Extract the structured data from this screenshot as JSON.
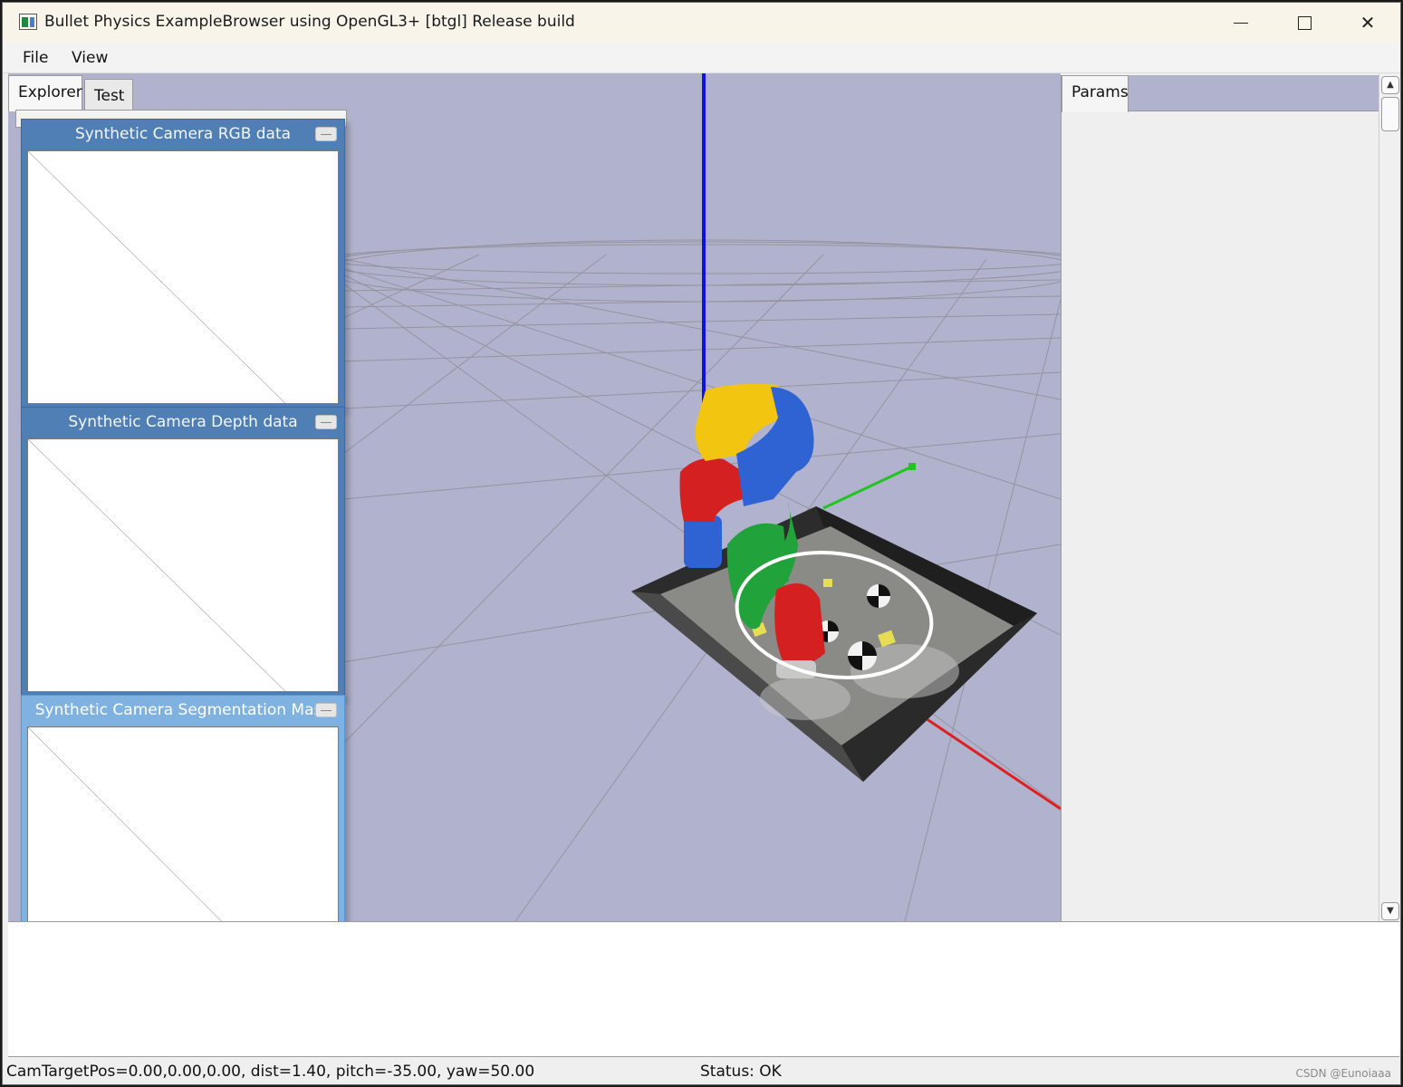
{
  "window": {
    "title": "Bullet Physics ExampleBrowser using OpenGL3+ [btgl] Release build"
  },
  "menu": {
    "items": [
      {
        "label": "File"
      },
      {
        "label": "View"
      }
    ]
  },
  "left_tabs": [
    {
      "label": "Explorer",
      "active": true
    },
    {
      "label": "Test",
      "active": false
    }
  ],
  "camera_windows": [
    {
      "title": "Synthetic Camera RGB data"
    },
    {
      "title": "Synthetic Camera Depth data"
    },
    {
      "title": "Synthetic Camera Segmentation Mask",
      "active": true
    }
  ],
  "params_panel": {
    "tab_label": "Params"
  },
  "viewport": {
    "background": "#b1b3ce",
    "axis_colors": {
      "x": "#e02020",
      "y": "#22c422",
      "z": "#1010e0"
    },
    "robot_colors": [
      "#f2c511",
      "#2f62d2",
      "#d42020",
      "#21a23a"
    ]
  },
  "status": {
    "camera": "CamTargetPos=0.00,0.00,0.00, dist=1.40, pitch=-35.00, yaw=50.00",
    "state": "Status: OK"
  },
  "watermark": "CSDN @Eunoiaaa"
}
